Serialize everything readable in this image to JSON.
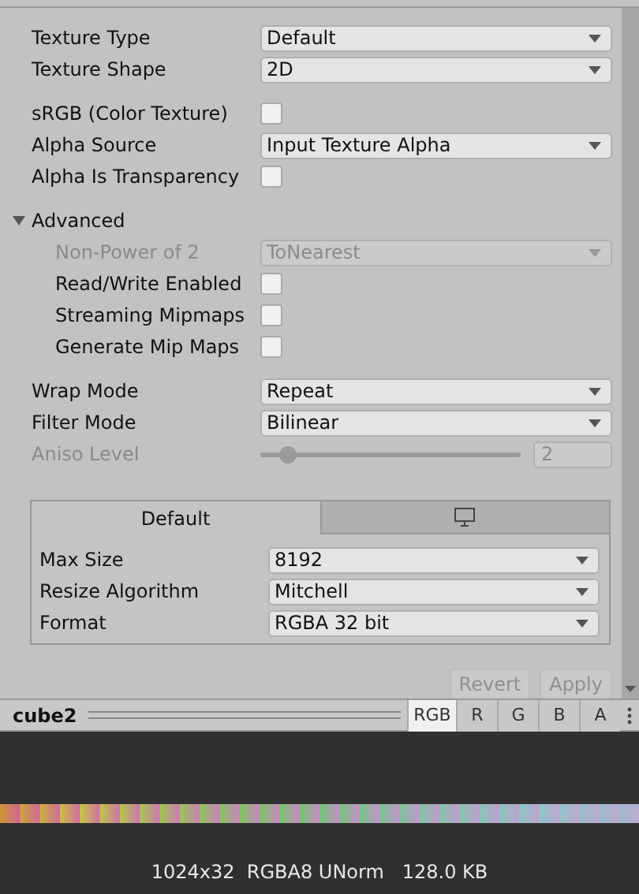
{
  "sections": [
    {
      "rows": [
        {
          "kind": "dropdown",
          "label": "Texture Type",
          "value": "Default",
          "disabled": false
        },
        {
          "kind": "dropdown",
          "label": "Texture Shape",
          "value": "2D",
          "disabled": false
        }
      ]
    },
    {
      "rows": [
        {
          "kind": "checkbox",
          "label": "sRGB (Color Texture)",
          "checked": false,
          "disabled": false
        },
        {
          "kind": "dropdown",
          "label": "Alpha Source",
          "value": "Input Texture Alpha",
          "disabled": false
        },
        {
          "kind": "checkbox",
          "label": "Alpha Is Transparency",
          "checked": false,
          "disabled": false
        }
      ]
    },
    {
      "rows": [
        {
          "kind": "foldout",
          "label": "Advanced",
          "expanded": true,
          "children": [
            {
              "kind": "dropdown",
              "label": "Non-Power of 2",
              "value": "ToNearest",
              "disabled": true
            },
            {
              "kind": "checkbox",
              "label": "Read/Write Enabled",
              "checked": false,
              "disabled": false
            },
            {
              "kind": "checkbox",
              "label": "Streaming Mipmaps",
              "checked": false,
              "disabled": false
            },
            {
              "kind": "checkbox",
              "label": "Generate Mip Maps",
              "checked": false,
              "disabled": false
            }
          ]
        }
      ]
    },
    {
      "rows": [
        {
          "kind": "dropdown",
          "label": "Wrap Mode",
          "value": "Repeat",
          "disabled": false
        },
        {
          "kind": "dropdown",
          "label": "Filter Mode",
          "value": "Bilinear",
          "disabled": false
        },
        {
          "kind": "slider",
          "label": "Aniso Level",
          "value": "2",
          "level": 0.1,
          "disabled": true
        }
      ]
    }
  ],
  "platform_tabs": [
    {
      "kind": "text",
      "label": "Default",
      "selected": true
    },
    {
      "kind": "monitor",
      "selected": false
    }
  ],
  "platform_rows": [
    {
      "label": "Max Size",
      "value": "8192"
    },
    {
      "label": "Resize Algorithm",
      "value": "Mitchell"
    },
    {
      "label": "Format",
      "value": "RGBA 32 bit"
    }
  ],
  "buttons": [
    {
      "label": "Revert",
      "disabled": true
    },
    {
      "label": "Apply",
      "disabled": true
    }
  ],
  "preview": {
    "title": "cube2",
    "channels": [
      {
        "label": "RGB",
        "selected": true
      },
      {
        "label": "R",
        "selected": false
      },
      {
        "label": "G",
        "selected": false
      },
      {
        "label": "B",
        "selected": false
      },
      {
        "label": "A",
        "selected": false
      }
    ],
    "info": "1024x32  RGBA8 UNorm   128.0 KB"
  }
}
